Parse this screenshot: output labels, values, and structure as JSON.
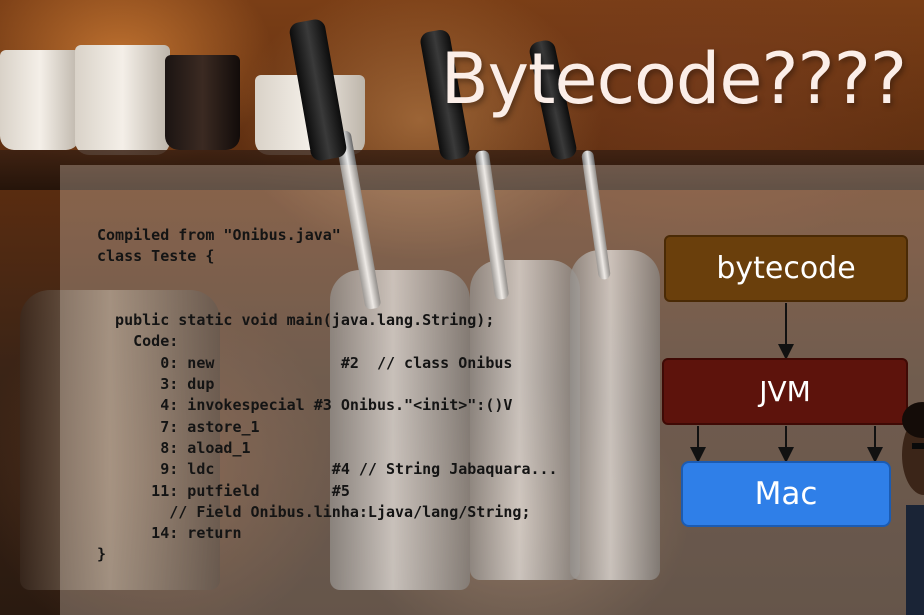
{
  "slide": {
    "title": "Bytecode????",
    "code_lines": [
      "Compiled from \"Onibus.java\"",
      "class Teste {",
      "",
      "",
      "  public static void main(java.lang.String);",
      "    Code:",
      "       0: new              #2  // class Onibus",
      "       3: dup",
      "       4: invokespecial #3 Onibus.\"<init>\":()V",
      "       7: astore_1",
      "       8: aload_1",
      "       9: ldc             #4 // String Jabaquara...",
      "      11: putfield        #5",
      "        // Field Onibus.linha:Ljava/lang/String;",
      "      14: return",
      "}"
    ],
    "diagram": {
      "bytecode_label": "bytecode",
      "jvm_label": "JVM",
      "mac_label": "Mac",
      "colors": {
        "bytecode": "#6a3f0c",
        "jvm": "#5d130c",
        "mac": "#2f7fe8"
      }
    }
  }
}
